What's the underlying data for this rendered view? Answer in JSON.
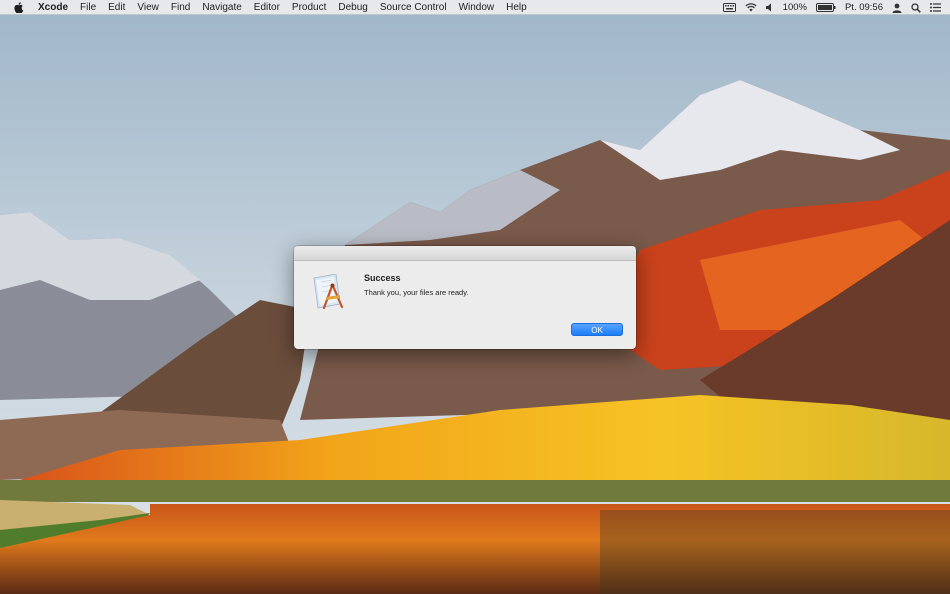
{
  "menubar": {
    "app_name": "Xcode",
    "menus": [
      "File",
      "Edit",
      "View",
      "Find",
      "Navigate",
      "Editor",
      "Product",
      "Debug",
      "Source Control",
      "Window",
      "Help"
    ],
    "battery": "100%",
    "clock": "Pt. 09:56",
    "icons": [
      "apple-icon",
      "keyboard-input-icon",
      "wifi-icon",
      "volume-icon",
      "battery-icon",
      "user-icon",
      "spotlight-search-icon",
      "notification-center-icon"
    ]
  },
  "dialog": {
    "title": "Success",
    "message": "Thank you, your files are ready.",
    "ok_label": "OK",
    "accent": "#1d7cf7",
    "icon": "xcode-app-icon"
  },
  "wallpaper": {
    "subject": "macOS High Sierra mountain lake"
  }
}
